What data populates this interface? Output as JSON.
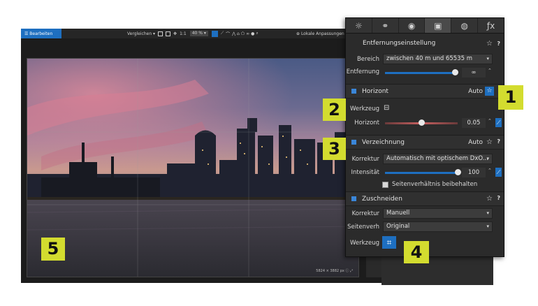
{
  "toolbar": {
    "edit_label": "☰ Bearbeiten",
    "compare_label": "Vergleichen ▾",
    "ratio_label": "1:1",
    "zoom_label": "40 % ▾",
    "local_adjust_label": "Lokale Anpassungen"
  },
  "photo": {
    "info": "5824 × 3882 px  ⓘ  ⤢"
  },
  "panel": {
    "tabs": [
      {
        "icon": "☼",
        "name": "sun-tab"
      },
      {
        "icon": "⚭",
        "name": "color-tab"
      },
      {
        "icon": "◉",
        "name": "detail-tab"
      },
      {
        "icon": "▣",
        "name": "geometry-tab"
      },
      {
        "icon": "◍",
        "name": "local-tab"
      },
      {
        "icon": "ƒx",
        "name": "effects-tab"
      }
    ],
    "distance": {
      "title": "Entfernungseinstellung",
      "range_label": "Bereich",
      "range_value": "zwischen 40 m und 65535 m",
      "distance_label": "Entfernung",
      "distance_value": "∞",
      "distance_fraction": 0.96
    },
    "horizon": {
      "title": "Horizont",
      "auto_label": "Auto",
      "tool_label": "Werkzeug",
      "tool_icon": "⊟",
      "horizon_label": "Horizont",
      "horizon_value": "0.05",
      "horizon_fraction": 0.5
    },
    "distortion": {
      "title": "Verzeichnung",
      "auto_label": "Auto",
      "correction_label": "Korrektur",
      "correction_value": "Automatisch mit optischem DxO...",
      "intensity_label": "Intensität",
      "intensity_value": "100",
      "intensity_fraction": 1.0,
      "keep_ratio_label": "Seitenverhältnis beibehalten"
    },
    "crop": {
      "title": "Zuschneiden",
      "correction_label": "Korrektur",
      "correction_value": "Manuell",
      "ratio_label": "Seitenverh",
      "ratio_value": "Original",
      "tool_label": "Werkzeug",
      "tool_icon": "⌗"
    },
    "star": "☆",
    "help": "?",
    "caret": "▾",
    "spin": "⌃⌄"
  },
  "callouts": [
    "1",
    "2",
    "3",
    "4",
    "5"
  ],
  "colors": {
    "accent": "#1e6fc0",
    "callout": "#d3dc2f",
    "panel_bg": "#2b2b2b"
  }
}
